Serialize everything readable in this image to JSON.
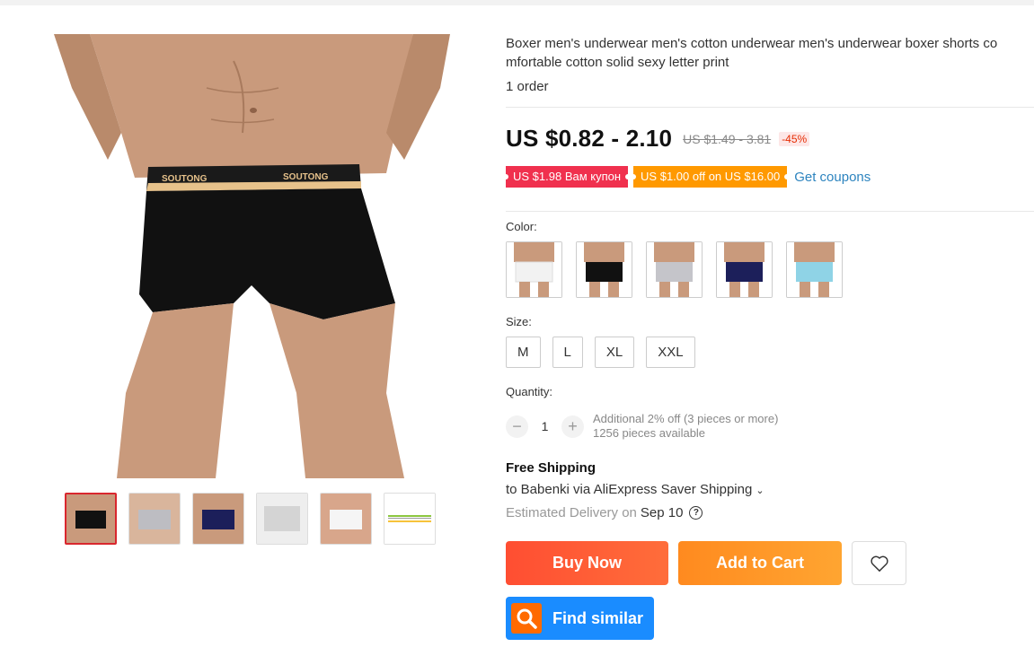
{
  "product": {
    "title_line1": "Boxer men's underwear men's cotton underwear men's underwear boxer shorts co",
    "title_line2": "mfortable cotton solid sexy letter print",
    "orders": "1 order",
    "main_image_brand": "SOUTONG"
  },
  "price": {
    "current": "US $0.82 - 2.10",
    "original": "US $1.49 - 3.81",
    "discount": "-45%"
  },
  "coupons": {
    "coupon1": "US $1.98 Вам купон",
    "coupon2": "US $1.00 off on US $16.00",
    "get_coupons": "Get coupons"
  },
  "options": {
    "color_label": "Color:",
    "colors": [
      "white",
      "black",
      "gray",
      "navy",
      "light-blue"
    ],
    "size_label": "Size:",
    "sizes": [
      "M",
      "L",
      "XL",
      "XXL"
    ]
  },
  "quantity": {
    "label": "Quantity:",
    "minus": "−",
    "value": "1",
    "plus": "+",
    "note1": "Additional 2% off (3 pieces or more)",
    "note2": "1256 pieces available"
  },
  "shipping": {
    "title": "Free Shipping",
    "to": "to Babenki via AliExpress Saver Shipping",
    "est_prefix": "Estimated Delivery on",
    "est_date": "Sep 10"
  },
  "actions": {
    "buy_now": "Buy Now",
    "add_to_cart": "Add to Cart",
    "find_similar": "Find similar"
  },
  "colors_theme": {
    "accent_red": "#ff4e32",
    "accent_orange": "#ffa531",
    "link_blue": "#2d84bf",
    "find_blue": "#1a8cff"
  }
}
